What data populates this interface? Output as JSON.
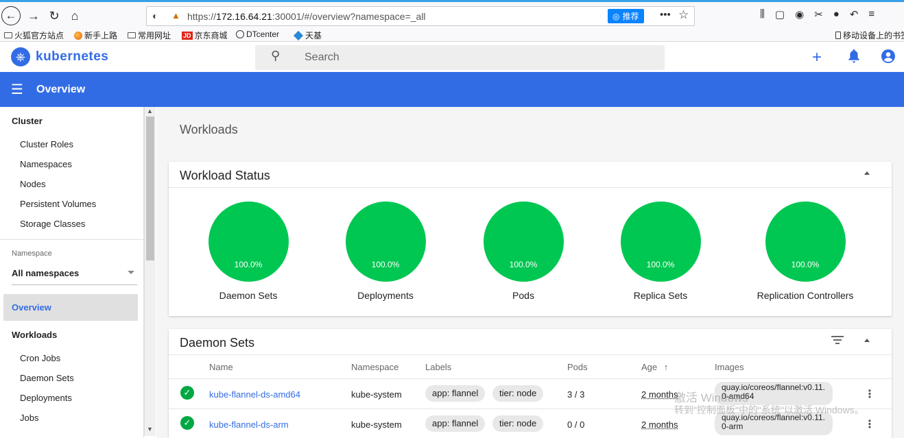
{
  "browser": {
    "url_prefix": "https://",
    "url_host": "172.16.64.21",
    "url_rest": ":30001/#/overview?namespace=_all",
    "recommend_label": "推荐",
    "bookmarks": [
      "火狐官方站点",
      "新手上路",
      "常用网址",
      "京东商城",
      "DTcenter",
      "天基"
    ],
    "mobile_bookmarks": "移动设备上的书签"
  },
  "app": {
    "logo_text": "kubernetes",
    "search_placeholder": "Search",
    "page_title": "Overview",
    "brand_color": "#326ce5"
  },
  "sidebar": {
    "cluster_heading": "Cluster",
    "cluster_items": [
      "Cluster Roles",
      "Namespaces",
      "Nodes",
      "Persistent Volumes",
      "Storage Classes"
    ],
    "namespace_label": "Namespace",
    "namespace_value": "All namespaces",
    "overview": "Overview",
    "workloads_heading": "Workloads",
    "workload_items": [
      "Cron Jobs",
      "Daemon Sets",
      "Deployments",
      "Jobs"
    ]
  },
  "main": {
    "section_title": "Workloads",
    "workload_status": {
      "title": "Workload Status",
      "status_color": "#00c752",
      "items": [
        {
          "label": "Daemon Sets",
          "percent": "100.0%"
        },
        {
          "label": "Deployments",
          "percent": "100.0%"
        },
        {
          "label": "Pods",
          "percent": "100.0%"
        },
        {
          "label": "Replica Sets",
          "percent": "100.0%"
        },
        {
          "label": "Replication Controllers",
          "percent": "100.0%"
        }
      ]
    },
    "daemon_sets": {
      "title": "Daemon Sets",
      "columns": [
        "Name",
        "Namespace",
        "Labels",
        "Pods",
        "Age",
        "Images"
      ],
      "rows": [
        {
          "name": "kube-flannel-ds-amd64",
          "namespace": "kube-system",
          "labels": [
            "app: flannel",
            "tier: node"
          ],
          "pods": "3 / 3",
          "age": "2 months",
          "image_line1": "quay.io/coreos/flannel:v0.11.",
          "image_line2": "0-amd64"
        },
        {
          "name": "kube-flannel-ds-arm",
          "namespace": "kube-system",
          "labels": [
            "app: flannel",
            "tier: node"
          ],
          "pods": "0 / 0",
          "age": "2 months",
          "image_line1": "quay.io/coreos/flannel:v0.11.",
          "image_line2": "0-arm"
        }
      ]
    }
  },
  "watermark": {
    "line1": "激活 Windows",
    "line2": "转到\"控制面板\"中的\"系统\"以激活 Windows。"
  }
}
